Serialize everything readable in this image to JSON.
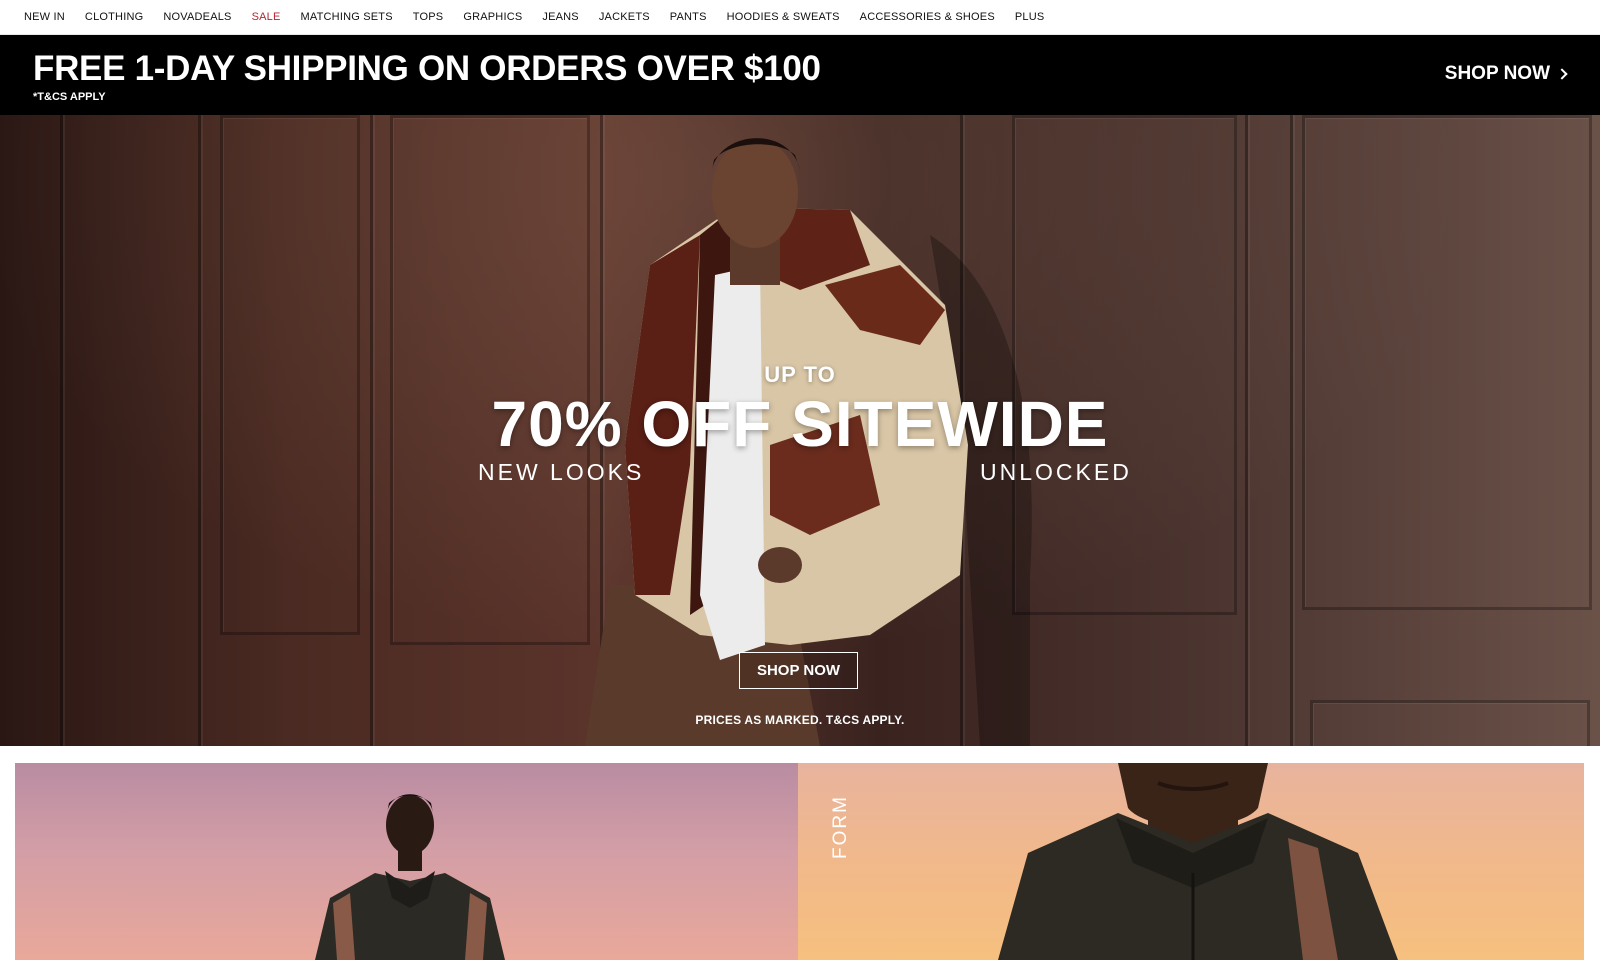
{
  "nav": {
    "items": [
      {
        "label": "NEW IN"
      },
      {
        "label": "CLOTHING"
      },
      {
        "label": "NOVADEALS"
      },
      {
        "label": "SALE"
      },
      {
        "label": "MATCHING SETS"
      },
      {
        "label": "TOPS"
      },
      {
        "label": "GRAPHICS"
      },
      {
        "label": "JEANS"
      },
      {
        "label": "JACKETS"
      },
      {
        "label": "PANTS"
      },
      {
        "label": "HOODIES & SWEATS"
      },
      {
        "label": "ACCESSORIES & SHOES"
      },
      {
        "label": "PLUS"
      }
    ],
    "sale_color": "#b3262f"
  },
  "shipping_banner": {
    "title": "FREE 1-DAY SHIPPING ON ORDERS OVER $100",
    "terms": "*T&CS APPLY",
    "cta": "SHOP NOW",
    "cta_icon": "chevron-right-icon",
    "background": "#000000"
  },
  "hero": {
    "upto": "UP TO",
    "headline": "70% OFF SITEWIDE",
    "sub_left": "NEW LOOKS",
    "sub_right": "UNLOCKED",
    "button": "SHOP NOW",
    "terms": "PRICES AS MARKED. T&CS APPLY."
  },
  "tiles": {
    "right_label": "FORM"
  }
}
